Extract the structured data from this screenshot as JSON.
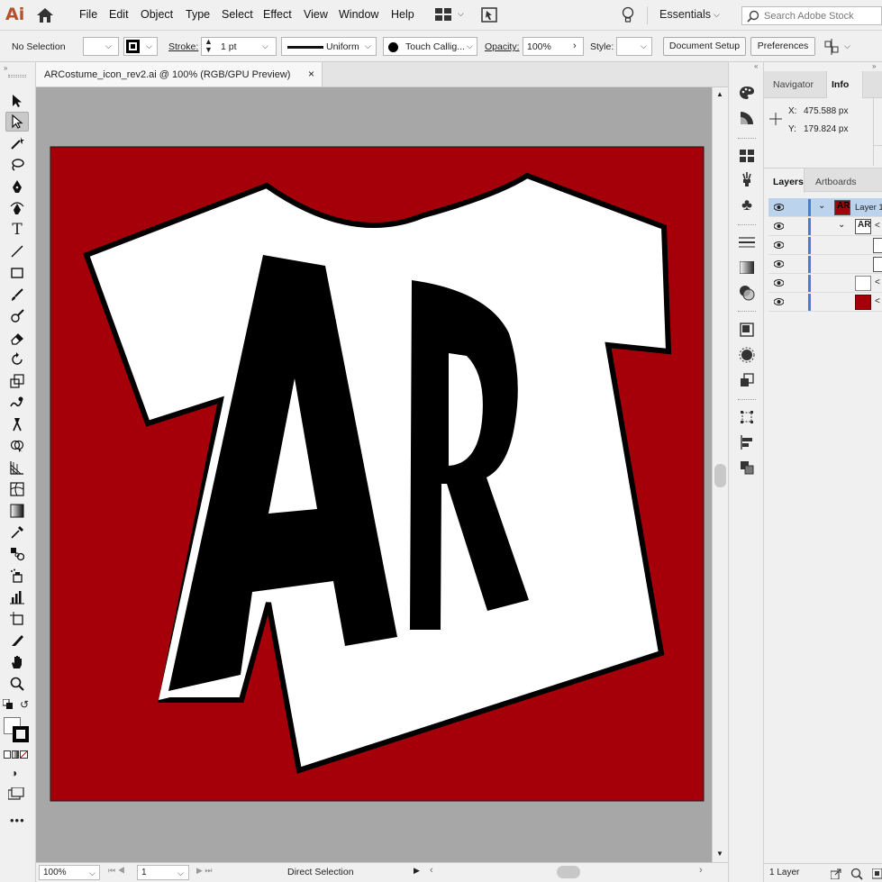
{
  "menubar": {
    "app_logo": "Ai",
    "items": [
      "File",
      "Edit",
      "Object",
      "Type",
      "Select",
      "Effect",
      "View",
      "Window",
      "Help"
    ],
    "workspace": "Essentials",
    "search_placeholder": "Search Adobe Stock"
  },
  "controlbar": {
    "selection": "No Selection",
    "stroke_label": "Stroke:",
    "stroke_value": "1 pt",
    "profile": "Uniform",
    "brush": "Touch Callig...",
    "opacity_label": "Opacity:",
    "opacity_value": "100%",
    "style_label": "Style:",
    "document_setup": "Document Setup",
    "preferences": "Preferences"
  },
  "document": {
    "tab_title": "ARCostume_icon_rev2.ai @ 100% (RGB/GPU Preview)",
    "close": "×"
  },
  "artwork": {
    "background_color": "#a50009",
    "shirt_color": "#ffffff",
    "letters_color": "#000000",
    "letter_a": "A",
    "letter_r": "R"
  },
  "statusbar": {
    "zoom": "100%",
    "artboard": "1",
    "tool": "Direct Selection"
  },
  "panels": {
    "tabs_top": [
      "Navigator",
      "Info"
    ],
    "info": {
      "x_label": "X:",
      "x_value": "475.588 px",
      "y_label": "Y:",
      "y_value": "179.824 px"
    },
    "tabs_layers": [
      "Layers",
      "Artboards"
    ],
    "layer_name": "Layer 1",
    "footer": "1 Layer"
  },
  "icons": {
    "toolbar": [
      "selection-icon",
      "direct-selection-icon",
      "magic-wand-icon",
      "lasso-icon",
      "pen-icon",
      "curvature-icon",
      "type-icon",
      "line-icon",
      "rectangle-icon",
      "paintbrush-icon",
      "shaper-icon",
      "eraser-icon",
      "rotate-icon",
      "scale-icon",
      "warp-icon",
      "puppet-warp-icon",
      "shape-builder-icon",
      "perspective-grid-icon",
      "mesh-icon",
      "gradient-icon",
      "eyedropper-icon",
      "blend-icon",
      "symbol-sprayer-icon",
      "column-graph-icon",
      "artboard-icon",
      "slice-icon",
      "hand-icon",
      "zoom-icon"
    ]
  }
}
